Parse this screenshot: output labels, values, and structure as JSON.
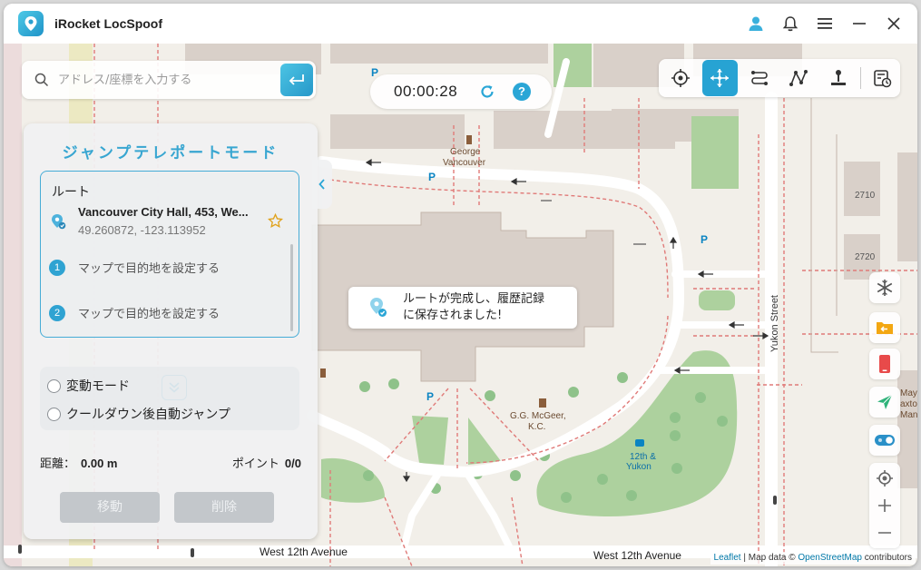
{
  "app": {
    "title": "iRocket LocSpoof"
  },
  "search": {
    "placeholder": "アドレス/座標を入力する"
  },
  "timer": {
    "time": "00:00:28",
    "help": "?"
  },
  "panel": {
    "title": "ジャンプテレポートモード",
    "route_label": "ルート",
    "start": {
      "name": "Vancouver City Hall, 453, We...",
      "coords": "49.260872, -123.113952"
    },
    "waypoints": [
      {
        "num": "1",
        "text": "マップで目的地を設定する"
      },
      {
        "num": "2",
        "text": "マップで目的地を設定する"
      }
    ],
    "options": [
      {
        "label": "変動モード"
      },
      {
        "label": "クールダウン後自動ジャンプ"
      }
    ],
    "distance_label": "距離：",
    "distance_value": "0.00 m",
    "points_label": "ポイント",
    "points_value": "0/0",
    "move_button": "移動",
    "delete_button": "削除"
  },
  "toast": {
    "line1": "ルートが完成し、履歴記録",
    "line2": "に保存されました!"
  },
  "map": {
    "labels": {
      "george": "George",
      "vancouver": "Vancouver",
      "mcgeer1": "G.G. McGeer,",
      "mcgeer2": "K.C.",
      "yukon_street": "Yukon Street",
      "twelfth1": "12th &",
      "twelfth2": "Yukon",
      "west12_left": "West 12th Avenue",
      "west12_right": "West 12th Avenue",
      "n2710": "2710",
      "n2720": "2720",
      "may1": "May",
      "may2": "axto",
      "may3": "Mans"
    },
    "attribution": {
      "leaflet": "Leaflet",
      "sep": " | Map data © ",
      "osm": "OpenStreetMap",
      "tail": " contributors"
    }
  },
  "colors": {
    "accent": "#27a3d3",
    "map_bg": "#f2efe9",
    "building": "#d9d0c9",
    "park": "#c8facc",
    "grass": "#add19e",
    "road": "#ffffff"
  }
}
